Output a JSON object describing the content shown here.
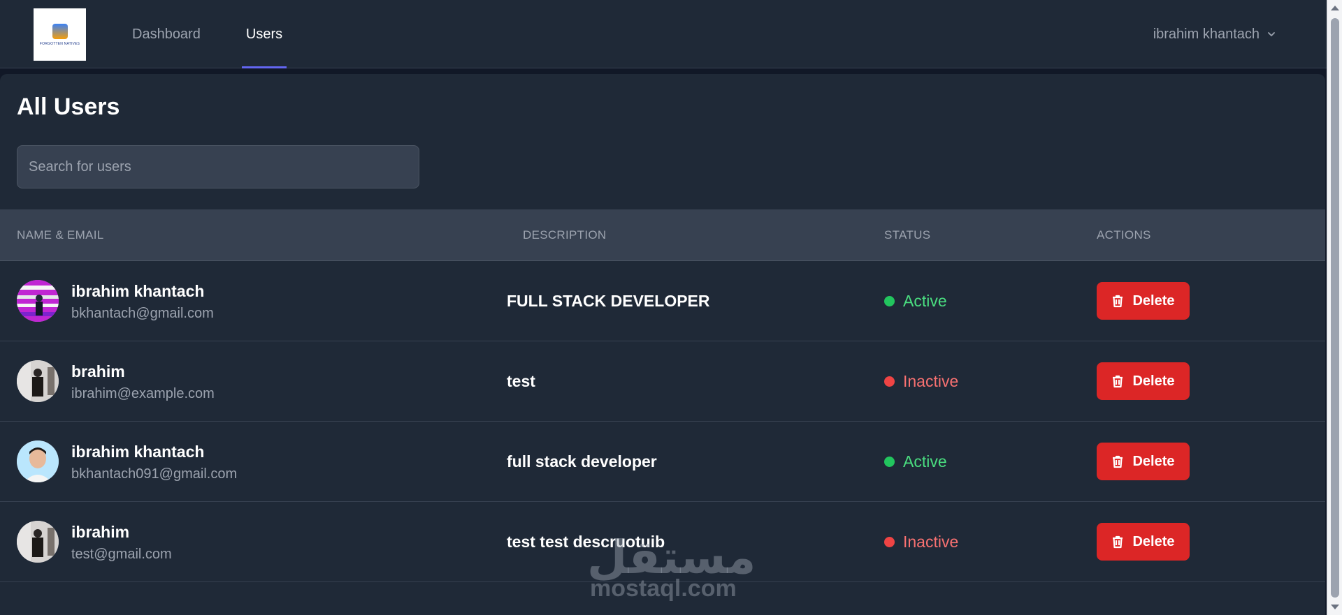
{
  "nav": {
    "logo_text": "FORGOTTEN NATIVES",
    "links": [
      {
        "label": "Dashboard",
        "active": false
      },
      {
        "label": "Users",
        "active": true
      }
    ],
    "user_name": "ibrahim khantach",
    "accent_color": "#6366f1"
  },
  "page": {
    "title": "All Users",
    "search_placeholder": "Search for users"
  },
  "table": {
    "headers": [
      "NAME & EMAIL",
      "DESCRIPTION",
      "STATUS",
      "ACTIONS"
    ],
    "rows": [
      {
        "name": "ibrahim khantach",
        "email": "bkhantach@gmail.com",
        "description": "FULL STACK DEVELOPER",
        "status": "Active",
        "action": "Delete",
        "avatar": "avatar-icon"
      },
      {
        "name": "brahim",
        "email": "ibrahim@example.com",
        "description": "test",
        "status": "Inactive",
        "action": "Delete",
        "avatar": "avatar-icon"
      },
      {
        "name": "ibrahim khantach",
        "email": "bkhantach091@gmail.com",
        "description": "full stack developer",
        "status": "Active",
        "action": "Delete",
        "avatar": "avatar-icon"
      },
      {
        "name": "ibrahim",
        "email": "test@gmail.com",
        "description": "test test descruotuib",
        "status": "Inactive",
        "action": "Delete",
        "avatar": "avatar-icon"
      }
    ]
  },
  "colors": {
    "active": "#4ade80",
    "inactive": "#f87171",
    "delete_button": "#dc2626"
  },
  "watermark": {
    "arabic": "مستقل",
    "latin": "mostaql.com"
  }
}
